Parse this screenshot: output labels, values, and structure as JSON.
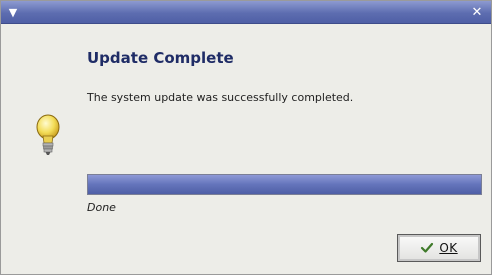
{
  "window": {
    "menu_icon": "chevron-down-icon",
    "close_icon": "close-icon",
    "titlebar_color": "#5d6db0"
  },
  "dialog": {
    "heading": "Update Complete",
    "message": "The system update was successfully completed.",
    "icon": "lightbulb-icon"
  },
  "progress": {
    "value": 1.0,
    "status": "Done",
    "fill_color": "#6474bb"
  },
  "buttons": {
    "ok_label": "OK",
    "ok_icon": "checkmark-icon"
  }
}
